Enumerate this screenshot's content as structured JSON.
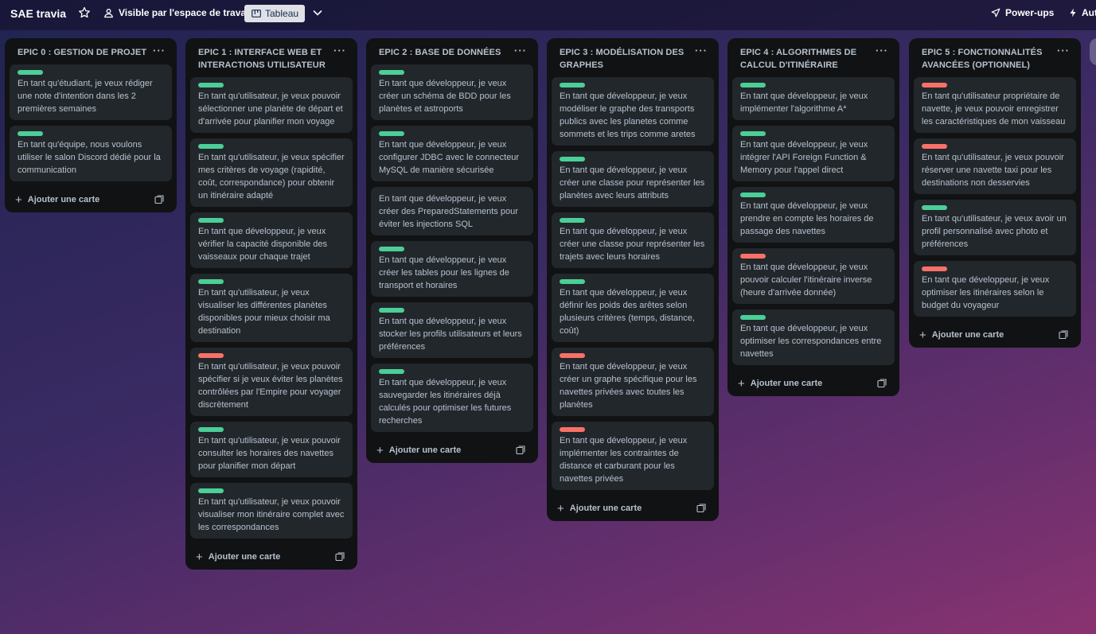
{
  "header": {
    "board_title": "SAE travia",
    "visibility_label": "Visible par l'espace de travail",
    "view_label": "Tableau",
    "powerups_label": "Power-ups",
    "automation_label": "Aut"
  },
  "add_card_label": "Ajouter une carte",
  "lists": [
    {
      "title": "EPIC 0 : GESTION DE PROJET",
      "cards": [
        {
          "label": "green",
          "text": "En tant qu'étudiant, je veux rédiger une note d'intention dans les 2 premières semaines"
        },
        {
          "label": "green",
          "text": "En tant qu'équipe, nous voulons utiliser le salon Discord dédié pour la communication"
        }
      ]
    },
    {
      "title": "EPIC 1 : INTERFACE WEB ET INTERACTIONS UTILISATEUR",
      "cards": [
        {
          "label": "green",
          "text": "En tant qu'utilisateur, je veux pouvoir sélectionner une planète de départ et d'arrivée pour planifier mon voyage"
        },
        {
          "label": "green",
          "text": "En tant qu'utilisateur, je veux spécifier mes critères de voyage (rapidité, coût, correspondance) pour obtenir un itinéraire adapté"
        },
        {
          "label": "green",
          "text": "En tant que développeur, je veux vérifier la capacité disponible des vaisseaux pour chaque trajet"
        },
        {
          "label": "green",
          "text": "En tant qu'utilisateur, je veux visualiser les différentes planètes disponibles pour mieux choisir ma destination"
        },
        {
          "label": "red",
          "text": "En tant qu'utilisateur, je veux pouvoir spécifier si je veux éviter les planètes contrôlées par l'Empire pour voyager discrètement"
        },
        {
          "label": "green",
          "text": "En tant qu'utilisateur, je veux pouvoir consulter les horaires des navettes pour planifier mon départ"
        },
        {
          "label": "green",
          "text": "En tant qu'utilisateur, je veux pouvoir visualiser mon itinéraire complet avec les correspondances"
        }
      ]
    },
    {
      "title": "EPIC 2 : BASE DE DONNÉES",
      "cards": [
        {
          "label": "green",
          "text": "En tant que développeur, je veux créer un schéma de BDD pour les planètes et astroports"
        },
        {
          "label": "green",
          "text": "En tant que développeur, je veux configurer JDBC avec le connecteur MySQL de manière sécurisée"
        },
        {
          "label": "",
          "text": "En tant que développeur, je veux créer des PreparedStatements pour éviter les injections SQL"
        },
        {
          "label": "green",
          "text": "En tant que développeur, je veux créer les tables pour les lignes de transport et horaires"
        },
        {
          "label": "green",
          "text": "En tant que développeur, je veux stocker les profils utilisateurs et leurs préférences"
        },
        {
          "label": "green",
          "text": "En tant que développeur, je veux sauvegarder les itinéraires déjà calculés pour optimiser les futures recherches"
        }
      ]
    },
    {
      "title": "EPIC 3 : MODÉLISATION DES GRAPHES",
      "cards": [
        {
          "label": "green",
          "text": "En tant que développeur, je veux modéliser le graphe des transports publics avec les planetes comme sommets et les trips comme aretes"
        },
        {
          "label": "green",
          "text": "En tant que développeur, je veux créer une classe pour représenter les planètes avec leurs attributs"
        },
        {
          "label": "green",
          "text": "En tant que développeur, je veux créer une classe pour représenter les trajets avec leurs horaires"
        },
        {
          "label": "green",
          "text": "En tant que développeur, je veux définir les poids des arêtes selon plusieurs critères (temps, distance, coût)"
        },
        {
          "label": "red",
          "text": "En tant que développeur, je veux créer un graphe spécifique pour les navettes privées avec toutes les planètes"
        },
        {
          "label": "red",
          "text": "En tant que développeur, je veux implémenter les contraintes de distance et carburant pour les navettes privées"
        }
      ]
    },
    {
      "title": "EPIC 4 : ALGORITHMES DE CALCUL D'ITINÉRAIRE",
      "cards": [
        {
          "label": "green",
          "text": "En tant que développeur, je veux implémenter l'algorithme A*"
        },
        {
          "label": "green",
          "text": "En tant que développeur, je veux intégrer l'API Foreign Function & Memory pour l'appel direct"
        },
        {
          "label": "green",
          "text": "En tant que développeur, je veux prendre en compte les horaires de passage des navettes"
        },
        {
          "label": "red",
          "text": "En tant que développeur, je veux pouvoir calculer l'itinéraire inverse (heure d'arrivée donnée)"
        },
        {
          "label": "green",
          "text": "En tant que développeur, je veux optimiser les correspondances entre navettes"
        }
      ]
    },
    {
      "title": "EPIC 5 : FONCTIONNALITÉS AVANCÉES (OPTIONNEL)",
      "cards": [
        {
          "label": "red",
          "text": "En tant qu'utilisateur propriétaire de navette, je veux pouvoir enregistrer les caractéristiques de mon vaisseau"
        },
        {
          "label": "red",
          "text": "En tant qu'utilisateur, je veux pouvoir réserver une navette taxi pour les destinations non desservies"
        },
        {
          "label": "green",
          "text": "En tant qu'utilisateur, je veux avoir un profil personnalisé avec photo et préférences"
        },
        {
          "label": "red",
          "text": "En tant que développeur, je veux optimiser les itinéraires selon le budget du voyageur"
        }
      ]
    }
  ]
}
